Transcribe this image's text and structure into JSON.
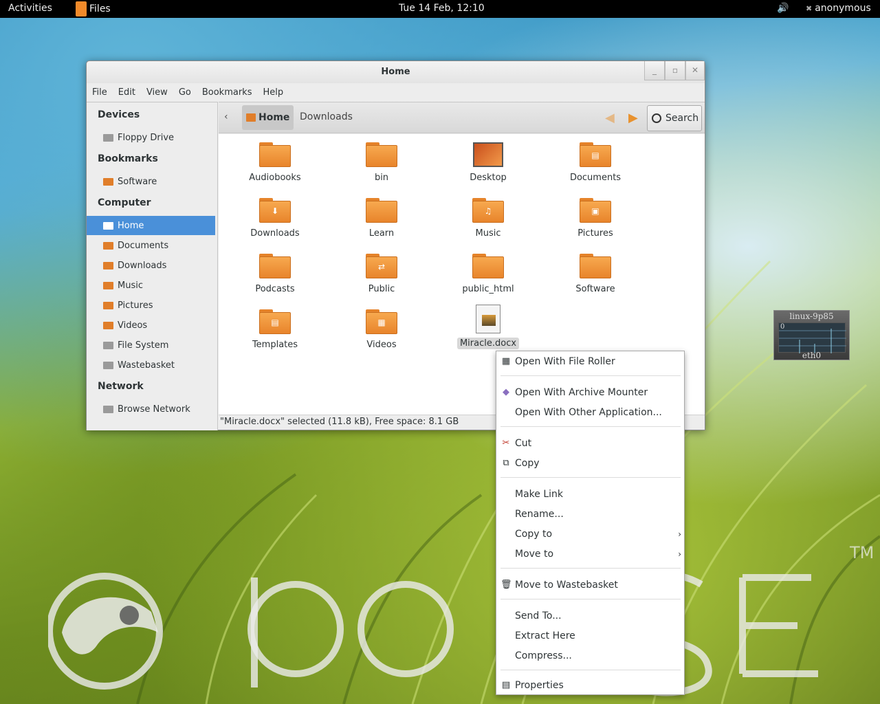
{
  "top_panel": {
    "activities": "Activities",
    "app_name": "Files",
    "clock": "Tue 14 Feb, 12:10",
    "volume_icon": "volume-icon",
    "user": "anonymous"
  },
  "window": {
    "title": "Home",
    "controls": {
      "minimize": "_",
      "maximize": "▫",
      "close": "✕"
    },
    "menubar": [
      "File",
      "Edit",
      "View",
      "Go",
      "Bookmarks",
      "Help"
    ]
  },
  "sidebar": {
    "sections": {
      "devices": "Devices",
      "bookmarks": "Bookmarks",
      "computer": "Computer",
      "network": "Network"
    },
    "devices": [
      "Floppy Drive"
    ],
    "bookmarks": [
      "Software"
    ],
    "computer": [
      "Home",
      "Documents",
      "Downloads",
      "Music",
      "Pictures",
      "Videos",
      "File System",
      "Wastebasket"
    ],
    "network": [
      "Browse Network"
    ],
    "active": "Home"
  },
  "pathbar": {
    "back": "‹",
    "crumbs": [
      "Home",
      "Downloads"
    ],
    "nav_back_icon": "arrow-left-icon",
    "nav_forward_icon": "arrow-right-icon",
    "search": "Search"
  },
  "items": [
    "Audiobooks",
    "bin",
    "Desktop",
    "Documents",
    "Downloads",
    "Learn",
    "Music",
    "Pictures",
    "Podcasts",
    "Public",
    "public_html",
    "Software",
    "Templates",
    "Videos",
    "Miracle.docx"
  ],
  "selected_item": "Miracle.docx",
  "statusbar": "\"Miracle.docx\" selected (11.8 kB), Free space: 8.1 GB",
  "netmon": {
    "host": "linux-9p85",
    "zero": "0",
    "iface": "eth0"
  },
  "context_menu": [
    {
      "label": "Open With File Roller",
      "icon": "archive-icon"
    },
    {
      "label": "Open With Archive Mounter",
      "icon": "diamond-icon"
    },
    {
      "label": "Open With Other Application..."
    },
    {
      "label": "Cut",
      "icon": "scissors-icon"
    },
    {
      "label": "Copy",
      "icon": "copy-icon"
    },
    {
      "label": "Make Link"
    },
    {
      "label": "Rename..."
    },
    {
      "label": "Copy to",
      "submenu": true
    },
    {
      "label": "Move to",
      "submenu": true
    },
    {
      "label": "Move to Wastebasket",
      "icon": "trash-icon"
    },
    {
      "label": "Send To..."
    },
    {
      "label": "Extract Here"
    },
    {
      "label": "Compress..."
    },
    {
      "label": "Properties",
      "icon": "properties-icon"
    }
  ],
  "wallpaper": {
    "brand_mark": "openSUSE",
    "trademark": "TM"
  },
  "colors": {
    "accent": "#4a90d9",
    "folder": "#e8842b",
    "panel": "#000000"
  }
}
